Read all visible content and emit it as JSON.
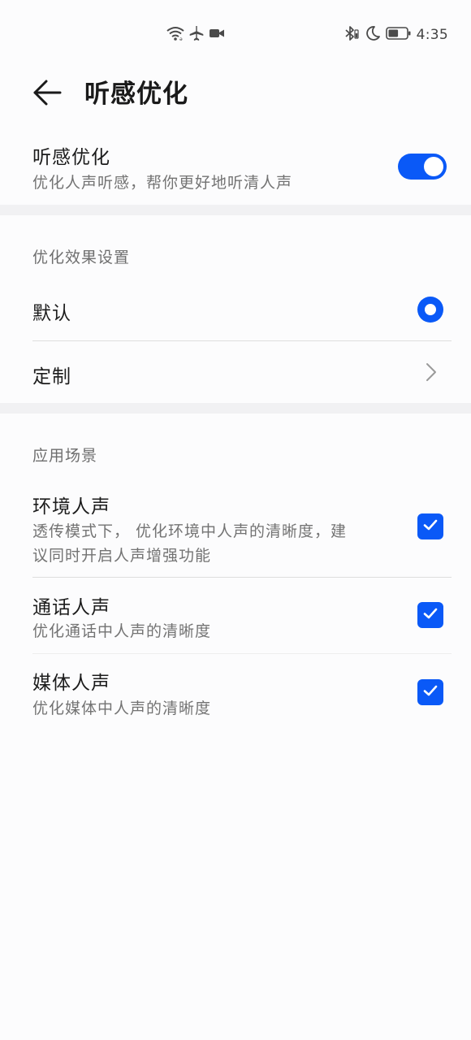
{
  "status_bar": {
    "time": "4:35",
    "icons": [
      "wifi-icon",
      "airplane-icon",
      "video-record-icon",
      "bluetooth-icon",
      "do-not-disturb-moon-icon",
      "battery-icon"
    ],
    "battery_level": 0.55
  },
  "app_bar": {
    "back_icon": "arrow-left-icon",
    "title": "听感优化"
  },
  "main_toggle": {
    "title": "听感优化",
    "subtitle": "优化人声听感，帮你更好地听清人声",
    "enabled": true
  },
  "effect_section": {
    "header": "优化效果设置",
    "options": [
      {
        "label": "默认",
        "selected": true,
        "control": "radio"
      },
      {
        "label": "定制",
        "control": "chevron"
      }
    ]
  },
  "scene_section": {
    "header": "应用场景",
    "items": [
      {
        "title": "环境人声",
        "subtitle_line1": "透传模式下， 优化环境中人声的清晰度，建",
        "subtitle_line2": "议同时开启人声增强功能",
        "checked": true
      },
      {
        "title": "通话人声",
        "subtitle_line1": "优化通话中人声的清晰度",
        "checked": true
      },
      {
        "title": "媒体人声",
        "subtitle_line1": "优化媒体中人声的清晰度",
        "checked": true
      }
    ]
  },
  "colors": {
    "accent": "#0a59f7",
    "background": "#fcfcfd",
    "section_gap": "#f1f1f3",
    "secondary_text": "#737373"
  }
}
